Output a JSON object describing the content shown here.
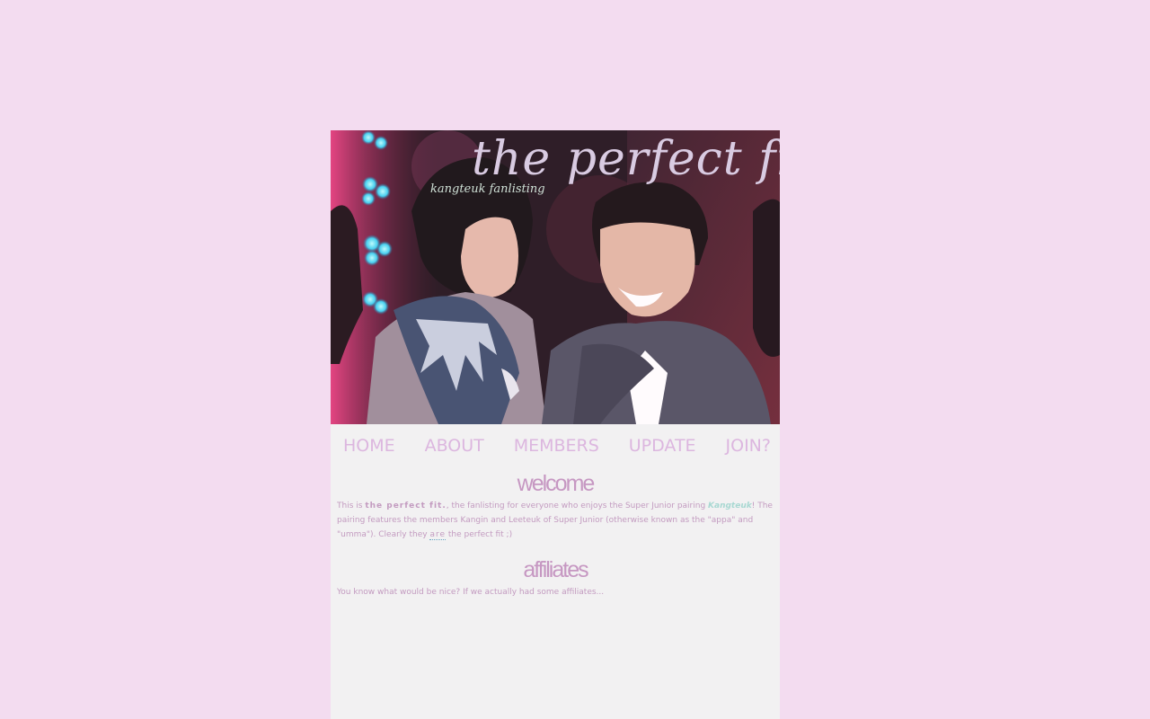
{
  "header": {
    "title": "the perfect fit.",
    "subtitle": "kangteuk fanlisting"
  },
  "nav": {
    "items": [
      "HOME",
      "ABOUT",
      "MEMBERS",
      "UPDATE",
      "JOIN?"
    ]
  },
  "welcome": {
    "heading": "welcome",
    "text_1": "This is ",
    "site_name": "the perfect fit.",
    "text_2": ", the fanlisting for everyone who enjoys the Super Junior pairing ",
    "pairing": "Kangteuk",
    "text_3": "! The pairing features the members Kangin and Leeteuk of Super Junior (otherwise known as the \"appa\" and \"umma\"). Clearly they ",
    "emphasis": "are",
    "text_4": " the perfect fit ;)"
  },
  "affiliates": {
    "heading": "affiliates",
    "text": "You know what would be nice? If we actually had some affiliates..."
  },
  "colors": {
    "background": "#f3dcf0",
    "content_bg": "#f2f1f2",
    "nav_text": "#dcb6df",
    "heading": "#c697c2",
    "body_text": "#c39bc0",
    "pairing_link": "#a8d8d2"
  }
}
